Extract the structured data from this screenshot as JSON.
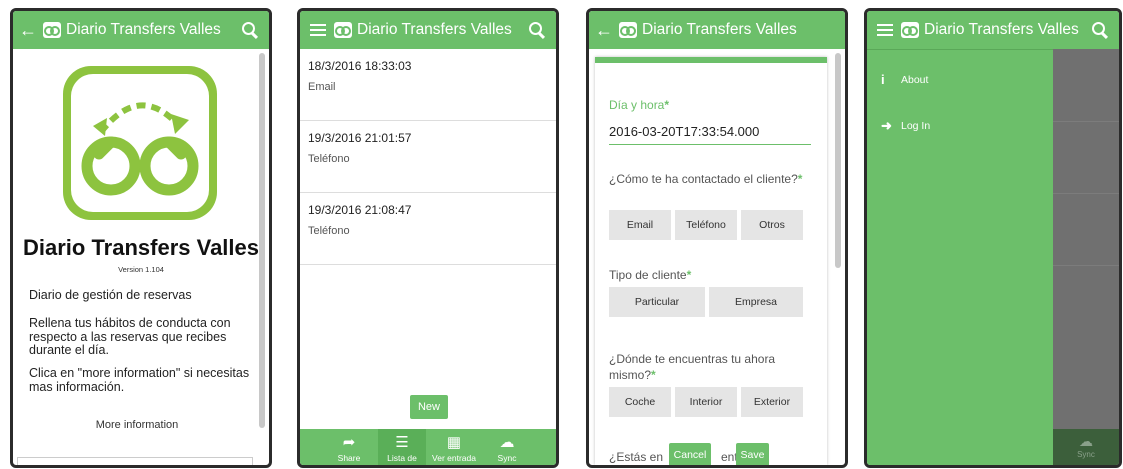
{
  "app": {
    "title": "Diario Transfers Valles",
    "version": "Version 1.104",
    "accent": "#6cbf6a",
    "icon_color": "#8dc33f"
  },
  "panel1": {
    "back_icon": "arrow-left-icon",
    "search_icon": "search-icon",
    "description": "Diario de gestión de reservas",
    "paragraph1": "Rellena tus hábitos de conducta con respecto a las reservas que recibes durante el día.",
    "paragraph2": "Clica en \"more information\" si necesitas mas información.",
    "more_link": "More information"
  },
  "panel2": {
    "entries": [
      {
        "date": "18/3/2016 18:33:03",
        "kind": "Email"
      },
      {
        "date": "19/3/2016 21:01:57",
        "kind": "Teléfono"
      },
      {
        "date": "19/3/2016 21:08:47",
        "kind": "Teléfono"
      }
    ],
    "new_button": "New",
    "tabs": [
      {
        "label": "Share",
        "icon": "share-icon"
      },
      {
        "label": "Lista de",
        "icon": "list-icon"
      },
      {
        "label": "Ver entrada",
        "icon": "grid-icon"
      },
      {
        "label": "Sync",
        "icon": "cloud-icon"
      }
    ]
  },
  "panel3": {
    "datetime_label": "Día y hora",
    "datetime_value": "2016-03-20T17:33:54.000",
    "contact_label": "¿Cómo te ha contactado el cliente?",
    "contact_options": [
      "Email",
      "Teléfono",
      "Otros"
    ],
    "client_label": "Tipo de cliente",
    "client_options": [
      "Particular",
      "Empresa"
    ],
    "location_label": "¿Dónde te encuentras tu ahora mismo?",
    "location_options": [
      "Coche",
      "Interior",
      "Exterior"
    ],
    "partial_label_left": "¿Estás en",
    "partial_label_right": "ent",
    "cancel_button": "Cancel",
    "save_button": "Save",
    "required_mark": "*"
  },
  "panel4": {
    "menu": [
      {
        "label": "About",
        "icon": "info-icon"
      },
      {
        "label": "Log In",
        "icon": "login-icon"
      }
    ],
    "sync_label": "Sync"
  }
}
